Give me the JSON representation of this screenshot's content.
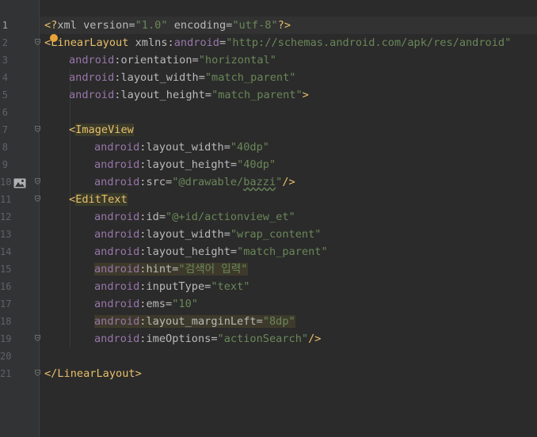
{
  "editor": {
    "lines": [
      {
        "n": "1",
        "parts": [
          [
            "p",
            "<?"
          ],
          [
            "an",
            "xml version="
          ],
          [
            "v",
            "\"1.0\""
          ],
          [
            "an",
            " encoding="
          ],
          [
            "v",
            "\"utf-8\""
          ],
          [
            "p",
            "?>"
          ]
        ]
      },
      {
        "n": "2",
        "parts": [
          [
            "p",
            "<"
          ],
          [
            "t",
            "LinearLayout"
          ],
          [
            "an",
            " xmlns:"
          ],
          [
            "ns",
            "android"
          ],
          [
            "an",
            "="
          ],
          [
            "v",
            "\"http://schemas.android.com/apk/res/android\""
          ]
        ]
      },
      {
        "n": "3",
        "parts": [
          [
            "ns",
            "android"
          ],
          [
            "an",
            ":orientation="
          ],
          [
            "v",
            "\"horizontal\""
          ]
        ]
      },
      {
        "n": "4",
        "parts": [
          [
            "ns",
            "android"
          ],
          [
            "an",
            ":layout_width="
          ],
          [
            "v",
            "\"match_parent\""
          ]
        ]
      },
      {
        "n": "5",
        "parts": [
          [
            "ns",
            "android"
          ],
          [
            "an",
            ":layout_height="
          ],
          [
            "v",
            "\"match_parent\""
          ],
          [
            "p",
            ">"
          ]
        ]
      },
      {
        "n": "6",
        "parts": []
      },
      {
        "n": "7",
        "parts": [
          [
            "p",
            "<"
          ],
          [
            "t",
            "ImageView"
          ]
        ]
      },
      {
        "n": "8",
        "parts": [
          [
            "ns",
            "android"
          ],
          [
            "an",
            ":layout_width="
          ],
          [
            "v",
            "\"40dp\""
          ]
        ]
      },
      {
        "n": "9",
        "parts": [
          [
            "ns",
            "android"
          ],
          [
            "an",
            ":layout_height="
          ],
          [
            "v",
            "\"40dp\""
          ]
        ]
      },
      {
        "n": "10",
        "parts": [
          [
            "ns",
            "android"
          ],
          [
            "an",
            ":src="
          ],
          [
            "v",
            "\"@drawable/"
          ],
          [
            "v",
            "bazzi"
          ],
          [
            "v",
            "\""
          ],
          [
            "p",
            "/>"
          ]
        ]
      },
      {
        "n": "11",
        "parts": [
          [
            "p",
            "<"
          ],
          [
            "t",
            "EditText"
          ]
        ]
      },
      {
        "n": "12",
        "parts": [
          [
            "ns",
            "android"
          ],
          [
            "an",
            ":id="
          ],
          [
            "v",
            "\"@+id/actionview_et\""
          ]
        ]
      },
      {
        "n": "13",
        "parts": [
          [
            "ns",
            "android"
          ],
          [
            "an",
            ":layout_width="
          ],
          [
            "v",
            "\"wrap_content\""
          ]
        ]
      },
      {
        "n": "14",
        "parts": [
          [
            "ns",
            "android"
          ],
          [
            "an",
            ":layout_height="
          ],
          [
            "v",
            "\"match_parent\""
          ]
        ]
      },
      {
        "n": "15",
        "parts": [
          [
            "ns",
            "android"
          ],
          [
            "an",
            ":hint="
          ],
          [
            "v",
            "\"검색어 입력\""
          ]
        ]
      },
      {
        "n": "16",
        "parts": [
          [
            "ns",
            "android"
          ],
          [
            "an",
            ":inputType="
          ],
          [
            "v",
            "\"text\""
          ]
        ]
      },
      {
        "n": "17",
        "parts": [
          [
            "ns",
            "android"
          ],
          [
            "an",
            ":ems="
          ],
          [
            "v",
            "\"10\""
          ]
        ]
      },
      {
        "n": "18",
        "parts": [
          [
            "ns",
            "android"
          ],
          [
            "an",
            ":layout_marginLeft="
          ],
          [
            "v",
            "\"8dp\""
          ]
        ]
      },
      {
        "n": "19",
        "parts": [
          [
            "ns",
            "android"
          ],
          [
            "an",
            ":imeOptions="
          ],
          [
            "v",
            "\"actionSearch\""
          ],
          [
            "p",
            "/>"
          ]
        ]
      },
      {
        "n": "20",
        "parts": []
      },
      {
        "n": "21",
        "parts": [
          [
            "p",
            "</"
          ],
          [
            "t",
            "LinearLayout"
          ],
          [
            "p",
            ">"
          ]
        ]
      }
    ]
  },
  "colors": {
    "background": "#2b2b2b",
    "gutter": "#313335",
    "tag": "#e8bf6a",
    "namespace": "#9876aa",
    "attribute": "#bababa",
    "value": "#6a8759",
    "line_number": "#606366"
  },
  "icons": {
    "bulb": "intention-bulb-icon",
    "image": "image-preview-icon",
    "fold": "fold-marker-icon"
  }
}
